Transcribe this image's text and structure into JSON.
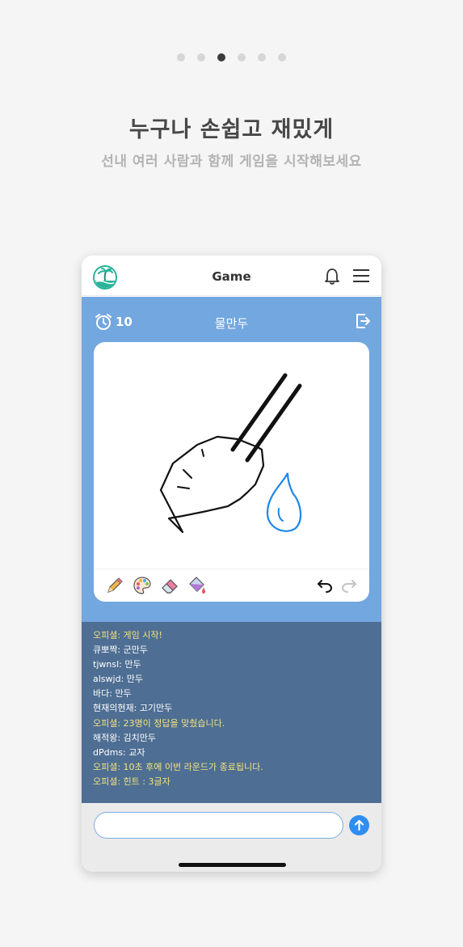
{
  "pager": {
    "count": 6,
    "active_index": 2
  },
  "headline": "누구나 손쉽고 재밌게",
  "subline": "선내 여러 사람과 함께 게임을 시작해보세요",
  "app": {
    "title": "Game",
    "icons": {
      "logo": "island-logo-icon",
      "bell": "bell-icon",
      "menu": "hamburger-menu-icon"
    }
  },
  "game": {
    "timer": "10",
    "word": "물만두",
    "icons": {
      "timer": "alarm-clock-icon",
      "exit": "exit-icon"
    }
  },
  "toolbar": {
    "tools": [
      "pencil-icon",
      "palette-icon",
      "eraser-icon",
      "paint-bucket-icon",
      "undo-icon",
      "redo-icon"
    ]
  },
  "chat": {
    "messages": [
      {
        "text": "오피셜: 게임 시작!",
        "system": true
      },
      {
        "text": "큐뽀짝: 군만두",
        "system": false
      },
      {
        "text": "tjwnsl: 만두",
        "system": false
      },
      {
        "text": "alswjd: 만두",
        "system": false
      },
      {
        "text": "바다: 만두",
        "system": false
      },
      {
        "text": "현재의현재: 고기만두",
        "system": false
      },
      {
        "text": "오피셜: 23명이 정답을 맞췄습니다.",
        "system": true
      },
      {
        "text": "해적왕: 김치만두",
        "system": false
      },
      {
        "text": "dPdms: 교자",
        "system": false
      },
      {
        "text": "오피셜: 10초 후에  이번 라운드가 종료됩니다.",
        "system": true
      },
      {
        "text": "오피셜: 힌트 : 3글자",
        "system": true
      }
    ]
  },
  "input": {
    "value": "",
    "placeholder": "",
    "send_icon": "arrow-up-icon"
  },
  "colors": {
    "game_bg": "#73a7df",
    "chat_bg": "#4e6e93",
    "system_text": "#f2e37c",
    "accent": "#2f8ef0"
  }
}
